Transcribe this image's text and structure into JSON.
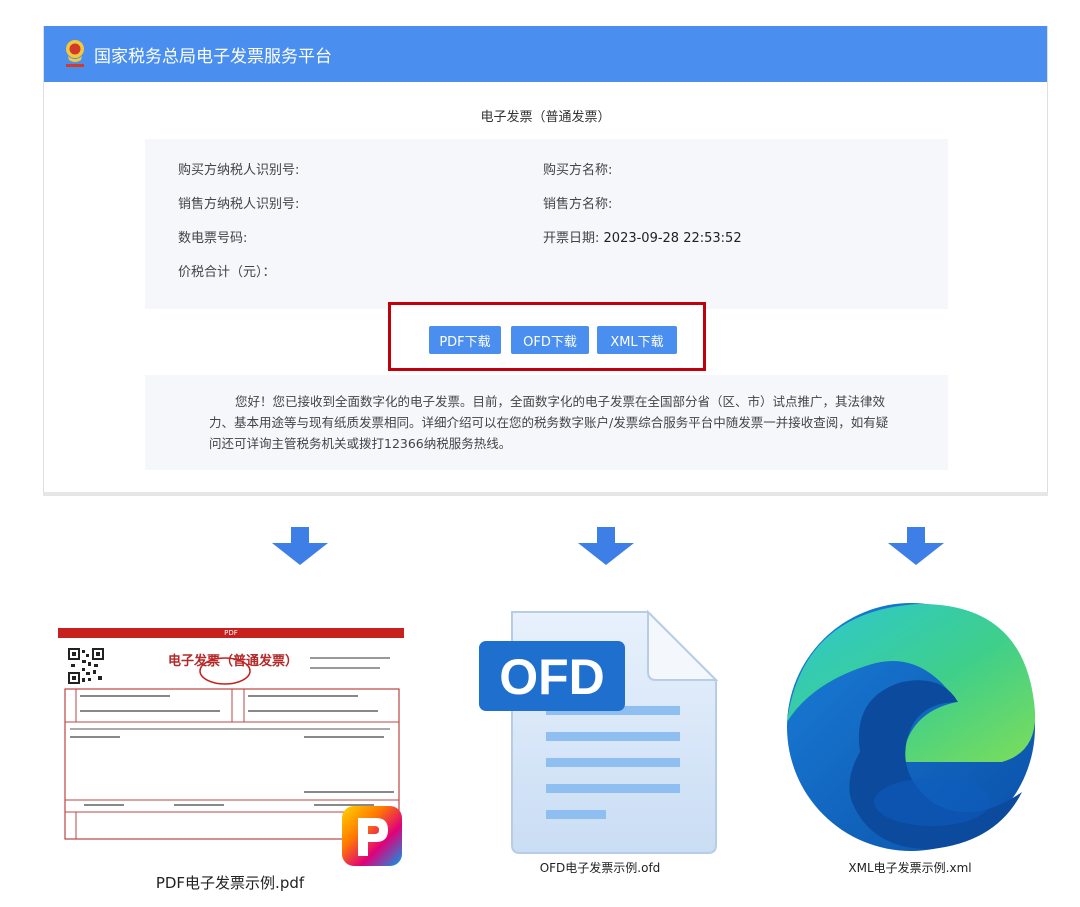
{
  "header": {
    "title": "国家税务总局电子发票服务平台"
  },
  "invoice": {
    "title": "电子发票（普通发票）",
    "buyer_tax_id_label": "购买方纳税人识别号:",
    "buyer_name_label": "购买方名称:",
    "seller_tax_id_label": "销售方纳税人识别号:",
    "seller_name_label": "销售方名称:",
    "invoice_no_label": "数电票号码:",
    "issue_date_label": "开票日期:",
    "issue_date_value": "2023-09-28 22:53:52",
    "total_label": "价税合计（元）："
  },
  "downloads": {
    "pdf_label": "PDF下载",
    "ofd_label": "OFD下载",
    "xml_label": "XML下载"
  },
  "notice": {
    "text": "您好！您已接收到全面数字化的电子发票。目前，全面数字化的电子发票在全国部分省（区、市）试点推广，其法律效力、基本用途等与现有纸质发票相同。详细介绍可以在您的税务数字账户/发票综合服务平台中随发票一并接收查阅，如有疑问还可详询主管税务机关或拨打12366纳税服务热线。"
  },
  "files": {
    "pdf_name": "PDF电子发票示例.pdf",
    "ofd_name": "OFD电子发票示例.ofd",
    "xml_name": "XML电子发票示例.xml",
    "ofd_badge": "OFD",
    "pdf_banner": "PDF",
    "pdf_doc_title": "电子发票（普通发票）"
  },
  "colors": {
    "accent": "#4a8ef0",
    "highlight": "#c0000a",
    "panel_bg": "#f5f7fb"
  },
  "icons": [
    "tax-emblem-icon",
    "down-arrow-icon",
    "pdf-file-icon",
    "ofd-file-icon",
    "edge-browser-icon"
  ]
}
